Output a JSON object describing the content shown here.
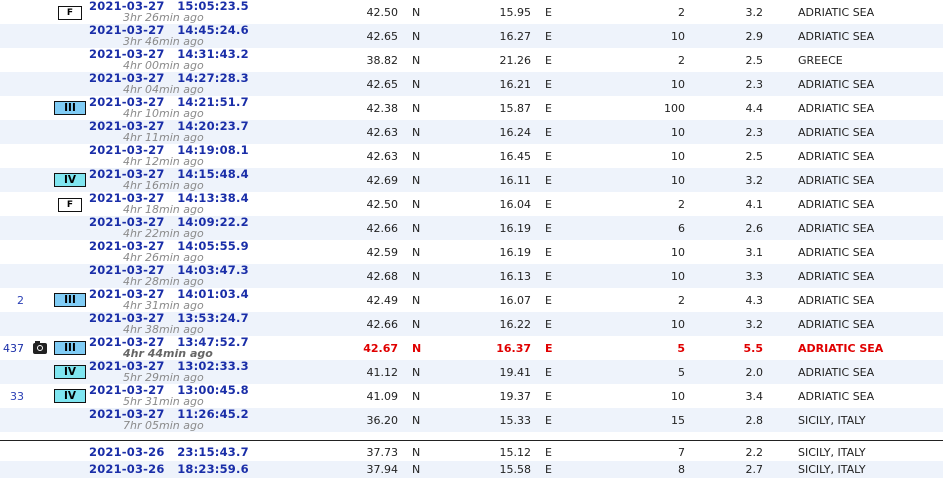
{
  "rows": [
    {
      "count": "",
      "photo": false,
      "intensity": "F",
      "date": "2021-03-27",
      "time": "15:05:23.5",
      "ago": "3hr 26min ago",
      "lat": "42.50",
      "ns": "N",
      "lon": "15.95",
      "ew": "E",
      "depth": "2",
      "mag": "3.2",
      "region": "ADRIATIC SEA"
    },
    {
      "count": "",
      "photo": false,
      "intensity": "",
      "date": "2021-03-27",
      "time": "14:45:24.6",
      "ago": "3hr 46min ago",
      "lat": "42.65",
      "ns": "N",
      "lon": "16.27",
      "ew": "E",
      "depth": "10",
      "mag": "2.9",
      "region": "ADRIATIC SEA"
    },
    {
      "count": "",
      "photo": false,
      "intensity": "",
      "date": "2021-03-27",
      "time": "14:31:43.2",
      "ago": "4hr 00min ago",
      "lat": "38.82",
      "ns": "N",
      "lon": "21.26",
      "ew": "E",
      "depth": "2",
      "mag": "2.5",
      "region": "GREECE"
    },
    {
      "count": "",
      "photo": false,
      "intensity": "",
      "date": "2021-03-27",
      "time": "14:27:28.3",
      "ago": "4hr 04min ago",
      "lat": "42.65",
      "ns": "N",
      "lon": "16.21",
      "ew": "E",
      "depth": "10",
      "mag": "2.3",
      "region": "ADRIATIC SEA"
    },
    {
      "count": "",
      "photo": false,
      "intensity": "III",
      "date": "2021-03-27",
      "time": "14:21:51.7",
      "ago": "4hr 10min ago",
      "lat": "42.38",
      "ns": "N",
      "lon": "15.87",
      "ew": "E",
      "depth": "100",
      "mag": "4.4",
      "region": "ADRIATIC SEA"
    },
    {
      "count": "",
      "photo": false,
      "intensity": "",
      "date": "2021-03-27",
      "time": "14:20:23.7",
      "ago": "4hr 11min ago",
      "lat": "42.63",
      "ns": "N",
      "lon": "16.24",
      "ew": "E",
      "depth": "10",
      "mag": "2.3",
      "region": "ADRIATIC SEA"
    },
    {
      "count": "",
      "photo": false,
      "intensity": "",
      "date": "2021-03-27",
      "time": "14:19:08.1",
      "ago": "4hr 12min ago",
      "lat": "42.63",
      "ns": "N",
      "lon": "16.45",
      "ew": "E",
      "depth": "10",
      "mag": "2.5",
      "region": "ADRIATIC SEA"
    },
    {
      "count": "",
      "photo": false,
      "intensity": "IV",
      "date": "2021-03-27",
      "time": "14:15:48.4",
      "ago": "4hr 16min ago",
      "lat": "42.69",
      "ns": "N",
      "lon": "16.11",
      "ew": "E",
      "depth": "10",
      "mag": "3.2",
      "region": "ADRIATIC SEA"
    },
    {
      "count": "",
      "photo": false,
      "intensity": "F",
      "date": "2021-03-27",
      "time": "14:13:38.4",
      "ago": "4hr 18min ago",
      "lat": "42.50",
      "ns": "N",
      "lon": "16.04",
      "ew": "E",
      "depth": "2",
      "mag": "4.1",
      "region": "ADRIATIC SEA"
    },
    {
      "count": "",
      "photo": false,
      "intensity": "",
      "date": "2021-03-27",
      "time": "14:09:22.2",
      "ago": "4hr 22min ago",
      "lat": "42.66",
      "ns": "N",
      "lon": "16.19",
      "ew": "E",
      "depth": "6",
      "mag": "2.6",
      "region": "ADRIATIC SEA"
    },
    {
      "count": "",
      "photo": false,
      "intensity": "",
      "date": "2021-03-27",
      "time": "14:05:55.9",
      "ago": "4hr 26min ago",
      "lat": "42.59",
      "ns": "N",
      "lon": "16.19",
      "ew": "E",
      "depth": "10",
      "mag": "3.1",
      "region": "ADRIATIC SEA"
    },
    {
      "count": "",
      "photo": false,
      "intensity": "",
      "date": "2021-03-27",
      "time": "14:03:47.3",
      "ago": "4hr 28min ago",
      "lat": "42.68",
      "ns": "N",
      "lon": "16.13",
      "ew": "E",
      "depth": "10",
      "mag": "3.3",
      "region": "ADRIATIC SEA"
    },
    {
      "count": "2",
      "photo": false,
      "intensity": "III",
      "date": "2021-03-27",
      "time": "14:01:03.4",
      "ago": "4hr 31min ago",
      "lat": "42.49",
      "ns": "N",
      "lon": "16.07",
      "ew": "E",
      "depth": "2",
      "mag": "4.3",
      "region": "ADRIATIC SEA"
    },
    {
      "count": "",
      "photo": false,
      "intensity": "",
      "date": "2021-03-27",
      "time": "13:53:24.7",
      "ago": "4hr 38min ago",
      "lat": "42.66",
      "ns": "N",
      "lon": "16.22",
      "ew": "E",
      "depth": "10",
      "mag": "3.2",
      "region": "ADRIATIC SEA"
    },
    {
      "count": "437",
      "photo": true,
      "intensity": "III",
      "date": "2021-03-27",
      "time": "13:47:52.7",
      "ago": "4hr 44min ago",
      "lat": "42.67",
      "ns": "N",
      "lon": "16.37",
      "ew": "E",
      "depth": "5",
      "mag": "5.5",
      "region": "ADRIATIC SEA",
      "highlight": true
    },
    {
      "count": "",
      "photo": false,
      "intensity": "IV",
      "date": "2021-03-27",
      "time": "13:02:33.3",
      "ago": "5hr 29min ago",
      "lat": "41.12",
      "ns": "N",
      "lon": "19.41",
      "ew": "E",
      "depth": "5",
      "mag": "2.0",
      "region": "ADRIATIC SEA"
    },
    {
      "count": "33",
      "photo": false,
      "intensity": "IV",
      "date": "2021-03-27",
      "time": "13:00:45.8",
      "ago": "5hr 31min ago",
      "lat": "41.09",
      "ns": "N",
      "lon": "19.37",
      "ew": "E",
      "depth": "10",
      "mag": "3.4",
      "region": "ADRIATIC SEA"
    },
    {
      "count": "",
      "photo": false,
      "intensity": "",
      "date": "2021-03-27",
      "time": "11:26:45.2",
      "ago": "7hr 05min ago",
      "lat": "36.20",
      "ns": "N",
      "lon": "15.33",
      "ew": "E",
      "depth": "15",
      "mag": "2.8",
      "region": "SICILY, ITALY"
    }
  ],
  "older_rows": [
    {
      "date": "2021-03-26",
      "time": "23:15:43.7",
      "lat": "37.73",
      "ns": "N",
      "lon": "15.12",
      "ew": "E",
      "depth": "7",
      "mag": "2.2",
      "region": "SICILY, ITALY"
    },
    {
      "date": "2021-03-26",
      "time": "18:23:59.6",
      "lat": "37.94",
      "ns": "N",
      "lon": "15.58",
      "ew": "E",
      "depth": "8",
      "mag": "2.7",
      "region": "SICILY, ITALY"
    }
  ],
  "colors": {
    "link": "#1a2ea8",
    "highlight": "#e00000",
    "row_alt": "#eef3fb",
    "intensity_III": "#80ccf5",
    "intensity_IV": "#7fe5f0"
  },
  "icons": {
    "photo": "camera-icon"
  }
}
